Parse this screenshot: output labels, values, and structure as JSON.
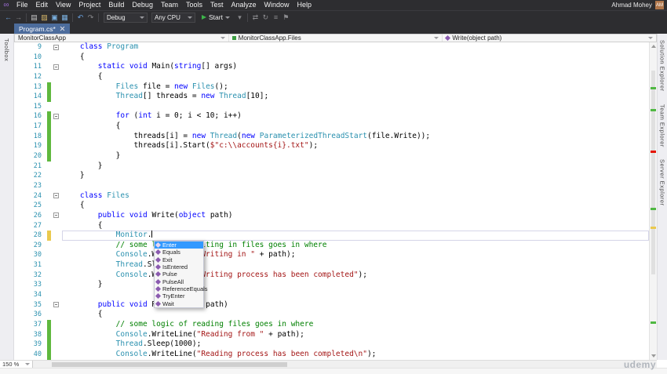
{
  "titlebar": {
    "logo_glyph": "∞",
    "menus": [
      "File",
      "Edit",
      "View",
      "Project",
      "Build",
      "Debug",
      "Team",
      "Tools",
      "Test",
      "Analyze",
      "Window",
      "Help"
    ],
    "user_name": "Ahmad Mohey",
    "user_initials": "AM"
  },
  "toolbar": {
    "left_icons": [
      {
        "name": "navigate-backward-icon",
        "glyph": "←",
        "color": "#6aa1e0"
      },
      {
        "name": "navigate-forward-icon",
        "glyph": "→",
        "color": "#8a8a8e"
      },
      {
        "name": "separator"
      },
      {
        "name": "new-file-icon",
        "glyph": "▤",
        "color": "#c8c8c8"
      },
      {
        "name": "open-file-icon",
        "glyph": "▨",
        "color": "#d8b86a"
      },
      {
        "name": "save-icon",
        "glyph": "▣",
        "color": "#7ab0e0"
      },
      {
        "name": "save-all-icon",
        "glyph": "▦",
        "color": "#7ab0e0"
      },
      {
        "name": "separator"
      },
      {
        "name": "undo-icon",
        "glyph": "↶",
        "color": "#6aa1e0"
      },
      {
        "name": "redo-icon",
        "glyph": "↷",
        "color": "#8a8a8e"
      },
      {
        "name": "separator"
      }
    ],
    "config_combo": "Debug",
    "platform_combo": "Any CPU",
    "start_label": "Start",
    "right_icons": [
      {
        "name": "debug-target-caret-icon",
        "glyph": "▾",
        "color": "#8a8a8e"
      },
      {
        "name": "separator"
      },
      {
        "name": "attach-process-icon",
        "glyph": "⇄",
        "color": "#8a8a8e"
      },
      {
        "name": "refresh-icon",
        "glyph": "↻",
        "color": "#8a8a8e"
      },
      {
        "name": "comment-icon",
        "glyph": "≡",
        "color": "#8a8a8e"
      },
      {
        "name": "bookmark-icon",
        "glyph": "⚑",
        "color": "#8a8a8e"
      }
    ]
  },
  "tabs": {
    "active": "Program.cs*"
  },
  "breadcrumb": {
    "segments": [
      {
        "label": "MonitorClassApp",
        "icon": "none"
      },
      {
        "label": "MonitorClassApp.Files",
        "icon": "class"
      },
      {
        "label": "Write(object path)",
        "icon": "method"
      }
    ]
  },
  "side": {
    "left_label": "Toolbox",
    "right_labels": [
      "Solution Explorer",
      "Team Explorer",
      "Server Explorer"
    ]
  },
  "editor": {
    "lines": [
      {
        "n": 9,
        "out": "m",
        "t": [
          [
            "p",
            "    "
          ],
          [
            "k",
            "class"
          ],
          [
            "p",
            " "
          ],
          [
            "c",
            "Program"
          ]
        ]
      },
      {
        "n": 10,
        "t": [
          [
            "p",
            "    {"
          ]
        ]
      },
      {
        "n": 11,
        "out": "m",
        "t": [
          [
            "p",
            "        "
          ],
          [
            "k",
            "static"
          ],
          [
            "p",
            " "
          ],
          [
            "k",
            "void"
          ],
          [
            "p",
            " Main("
          ],
          [
            "k",
            "string"
          ],
          [
            "p",
            "[] args)"
          ]
        ]
      },
      {
        "n": 12,
        "t": [
          [
            "p",
            "        {"
          ]
        ]
      },
      {
        "n": 13,
        "chg": "g",
        "t": [
          [
            "p",
            "            "
          ],
          [
            "c",
            "Files"
          ],
          [
            "p",
            " file = "
          ],
          [
            "k",
            "new"
          ],
          [
            "p",
            " "
          ],
          [
            "c",
            "Files"
          ],
          [
            "p",
            "();"
          ]
        ]
      },
      {
        "n": 14,
        "chg": "g",
        "t": [
          [
            "p",
            "            "
          ],
          [
            "c",
            "Thread"
          ],
          [
            "p",
            "[] threads = "
          ],
          [
            "k",
            "new"
          ],
          [
            "p",
            " "
          ],
          [
            "c",
            "Thread"
          ],
          [
            "p",
            "[10];"
          ]
        ]
      },
      {
        "n": 15,
        "t": []
      },
      {
        "n": 16,
        "chg": "g",
        "out": "m",
        "t": [
          [
            "p",
            "            "
          ],
          [
            "k",
            "for"
          ],
          [
            "p",
            " ("
          ],
          [
            "k",
            "int"
          ],
          [
            "p",
            " i = 0; i < 10; i++)"
          ]
        ]
      },
      {
        "n": 17,
        "chg": "g",
        "t": [
          [
            "p",
            "            {"
          ]
        ]
      },
      {
        "n": 18,
        "chg": "g",
        "t": [
          [
            "p",
            "                threads[i] = "
          ],
          [
            "k",
            "new"
          ],
          [
            "p",
            " "
          ],
          [
            "c",
            "Thread"
          ],
          [
            "p",
            "("
          ],
          [
            "k",
            "new"
          ],
          [
            "p",
            " "
          ],
          [
            "c",
            "ParameterizedThreadStart"
          ],
          [
            "p",
            "(file.Write));"
          ]
        ]
      },
      {
        "n": 19,
        "chg": "g",
        "t": [
          [
            "p",
            "                threads[i].Start("
          ],
          [
            "s",
            "$\"c:\\\\accounts{i}.txt\""
          ],
          [
            "p",
            ");"
          ]
        ]
      },
      {
        "n": 20,
        "chg": "g",
        "t": [
          [
            "p",
            "            }"
          ]
        ]
      },
      {
        "n": 21,
        "t": [
          [
            "p",
            "        }"
          ]
        ]
      },
      {
        "n": 22,
        "t": [
          [
            "p",
            "    }"
          ]
        ]
      },
      {
        "n": 23,
        "t": []
      },
      {
        "n": 24,
        "out": "m",
        "t": [
          [
            "p",
            "    "
          ],
          [
            "k",
            "class"
          ],
          [
            "p",
            " "
          ],
          [
            "c",
            "Files"
          ]
        ]
      },
      {
        "n": 25,
        "t": [
          [
            "p",
            "    {"
          ]
        ]
      },
      {
        "n": 26,
        "out": "m",
        "t": [
          [
            "p",
            "        "
          ],
          [
            "k",
            "public"
          ],
          [
            "p",
            " "
          ],
          [
            "k",
            "void"
          ],
          [
            "p",
            " Write("
          ],
          [
            "k",
            "object"
          ],
          [
            "p",
            " path)"
          ]
        ]
      },
      {
        "n": 27,
        "t": [
          [
            "p",
            "        {"
          ]
        ]
      },
      {
        "n": 28,
        "chg": "y",
        "cur": true,
        "caret": true,
        "t": [
          [
            "p",
            "            "
          ],
          [
            "c",
            "Monitor"
          ],
          [
            "p",
            "."
          ]
        ]
      },
      {
        "n": 29,
        "t": [
          [
            "p",
            "            "
          ],
          [
            "m",
            "// some logic of writing in files goes in where"
          ]
        ]
      },
      {
        "n": 30,
        "t": [
          [
            "p",
            "            "
          ],
          [
            "c",
            "Console"
          ],
          [
            "p",
            ".WriteLine("
          ],
          [
            "s",
            "\"Writing in \""
          ],
          [
            "p",
            " + path);"
          ]
        ]
      },
      {
        "n": 31,
        "t": [
          [
            "p",
            "            "
          ],
          [
            "c",
            "Thread"
          ],
          [
            "p",
            ".Sleep(1000);"
          ]
        ]
      },
      {
        "n": 32,
        "t": [
          [
            "p",
            "            "
          ],
          [
            "c",
            "Console"
          ],
          [
            "p",
            ".WriteLine("
          ],
          [
            "s",
            "\"Writing process has been completed\""
          ],
          [
            "p",
            ");"
          ]
        ]
      },
      {
        "n": 33,
        "t": [
          [
            "p",
            "        }"
          ]
        ]
      },
      {
        "n": 34,
        "t": []
      },
      {
        "n": 35,
        "out": "m",
        "t": [
          [
            "p",
            "        "
          ],
          [
            "k",
            "public"
          ],
          [
            "p",
            " "
          ],
          [
            "k",
            "void"
          ],
          [
            "p",
            " Read("
          ],
          [
            "k",
            "object"
          ],
          [
            "p",
            " path)"
          ]
        ]
      },
      {
        "n": 36,
        "t": [
          [
            "p",
            "        {"
          ]
        ]
      },
      {
        "n": 37,
        "chg": "g",
        "t": [
          [
            "p",
            "            "
          ],
          [
            "m",
            "// some logic of reading files goes in where"
          ]
        ]
      },
      {
        "n": 38,
        "chg": "g",
        "t": [
          [
            "p",
            "            "
          ],
          [
            "c",
            "Console"
          ],
          [
            "p",
            ".WriteLine("
          ],
          [
            "s",
            "\"Reading from \""
          ],
          [
            "p",
            " + path);"
          ]
        ]
      },
      {
        "n": 39,
        "chg": "g",
        "t": [
          [
            "p",
            "            "
          ],
          [
            "c",
            "Thread"
          ],
          [
            "p",
            ".Sleep(1000);"
          ]
        ]
      },
      {
        "n": 40,
        "chg": "g",
        "t": [
          [
            "p",
            "            "
          ],
          [
            "c",
            "Console"
          ],
          [
            "p",
            ".WriteLine("
          ],
          [
            "s",
            "\"Reading process has been completed\\n\""
          ],
          [
            "p",
            ");"
          ]
        ]
      }
    ]
  },
  "intellisense": {
    "selected": 0,
    "items": [
      {
        "label": "Enter",
        "icon": "method-icon"
      },
      {
        "label": "Equals",
        "icon": "method-icon"
      },
      {
        "label": "Exit",
        "icon": "method-icon"
      },
      {
        "label": "IsEntered",
        "icon": "method-icon"
      },
      {
        "label": "Pulse",
        "icon": "method-icon"
      },
      {
        "label": "PulseAll",
        "icon": "method-icon"
      },
      {
        "label": "ReferenceEquals",
        "icon": "method-icon"
      },
      {
        "label": "TryEnter",
        "icon": "method-icon"
      },
      {
        "label": "Wait",
        "icon": "method-icon"
      }
    ]
  },
  "vscroll": {
    "marks": [
      {
        "p": 0.14,
        "c": "#4fb842"
      },
      {
        "p": 0.21,
        "c": "#4fb842"
      },
      {
        "p": 0.34,
        "c": "#e51400"
      },
      {
        "p": 0.52,
        "c": "#4fb842"
      },
      {
        "p": 0.58,
        "c": "#eac94e"
      },
      {
        "p": 0.88,
        "c": "#4fb842"
      }
    ]
  },
  "statusbar": {
    "zoom": "150 %"
  },
  "watermark": {
    "text": "udemy"
  },
  "colors": {
    "titlebar_bg": "#2d2d30",
    "active_tab": "#4c6c9c",
    "keyword": "#0000ff",
    "type": "#2b91af",
    "string": "#a31515",
    "comment": "#008000",
    "change_saved": "#5fb83e",
    "change_unsaved": "#eac94e",
    "selection": "#3399ff"
  }
}
